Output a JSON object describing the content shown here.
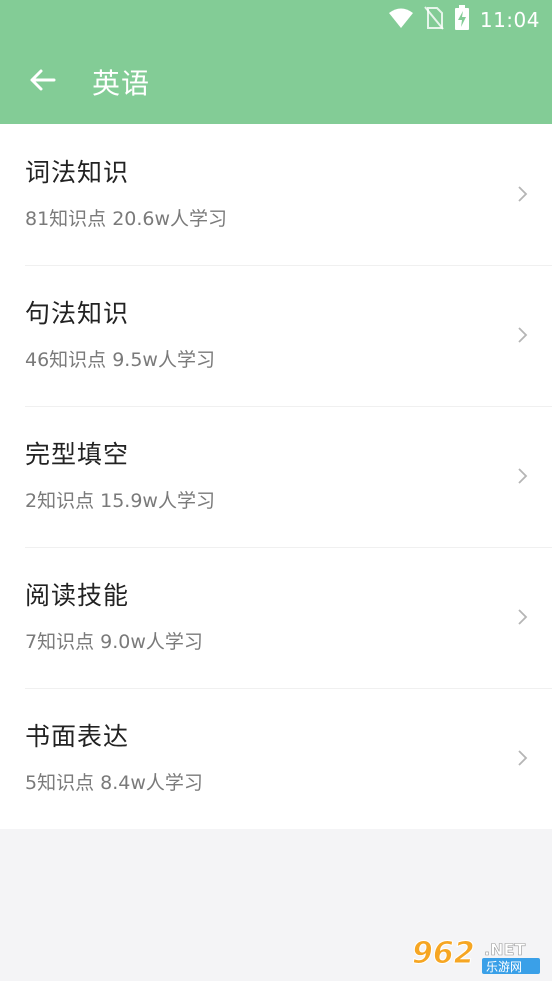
{
  "status_bar": {
    "time": "11:04",
    "icons": [
      "wifi-icon",
      "no-sim-icon",
      "battery-charging-icon"
    ]
  },
  "app_bar": {
    "title": "英语",
    "back_icon": "arrow-left-icon"
  },
  "categories": [
    {
      "title": "词法知识",
      "subtitle": "81知识点 20.6w人学习"
    },
    {
      "title": "句法知识",
      "subtitle": "46知识点 9.5w人学习"
    },
    {
      "title": "完型填空",
      "subtitle": "2知识点 15.9w人学习"
    },
    {
      "title": "阅读技能",
      "subtitle": "7知识点 9.0w人学习"
    },
    {
      "title": "书面表达",
      "subtitle": "5知识点 8.4w人学习"
    }
  ],
  "watermark": {
    "number": "962",
    "suffix": ".NET",
    "text": "乐游网"
  },
  "colors": {
    "header": "#83cc96",
    "background": "#f4f4f6",
    "title_text": "#222222",
    "subtitle_text": "#7a7a7a"
  }
}
